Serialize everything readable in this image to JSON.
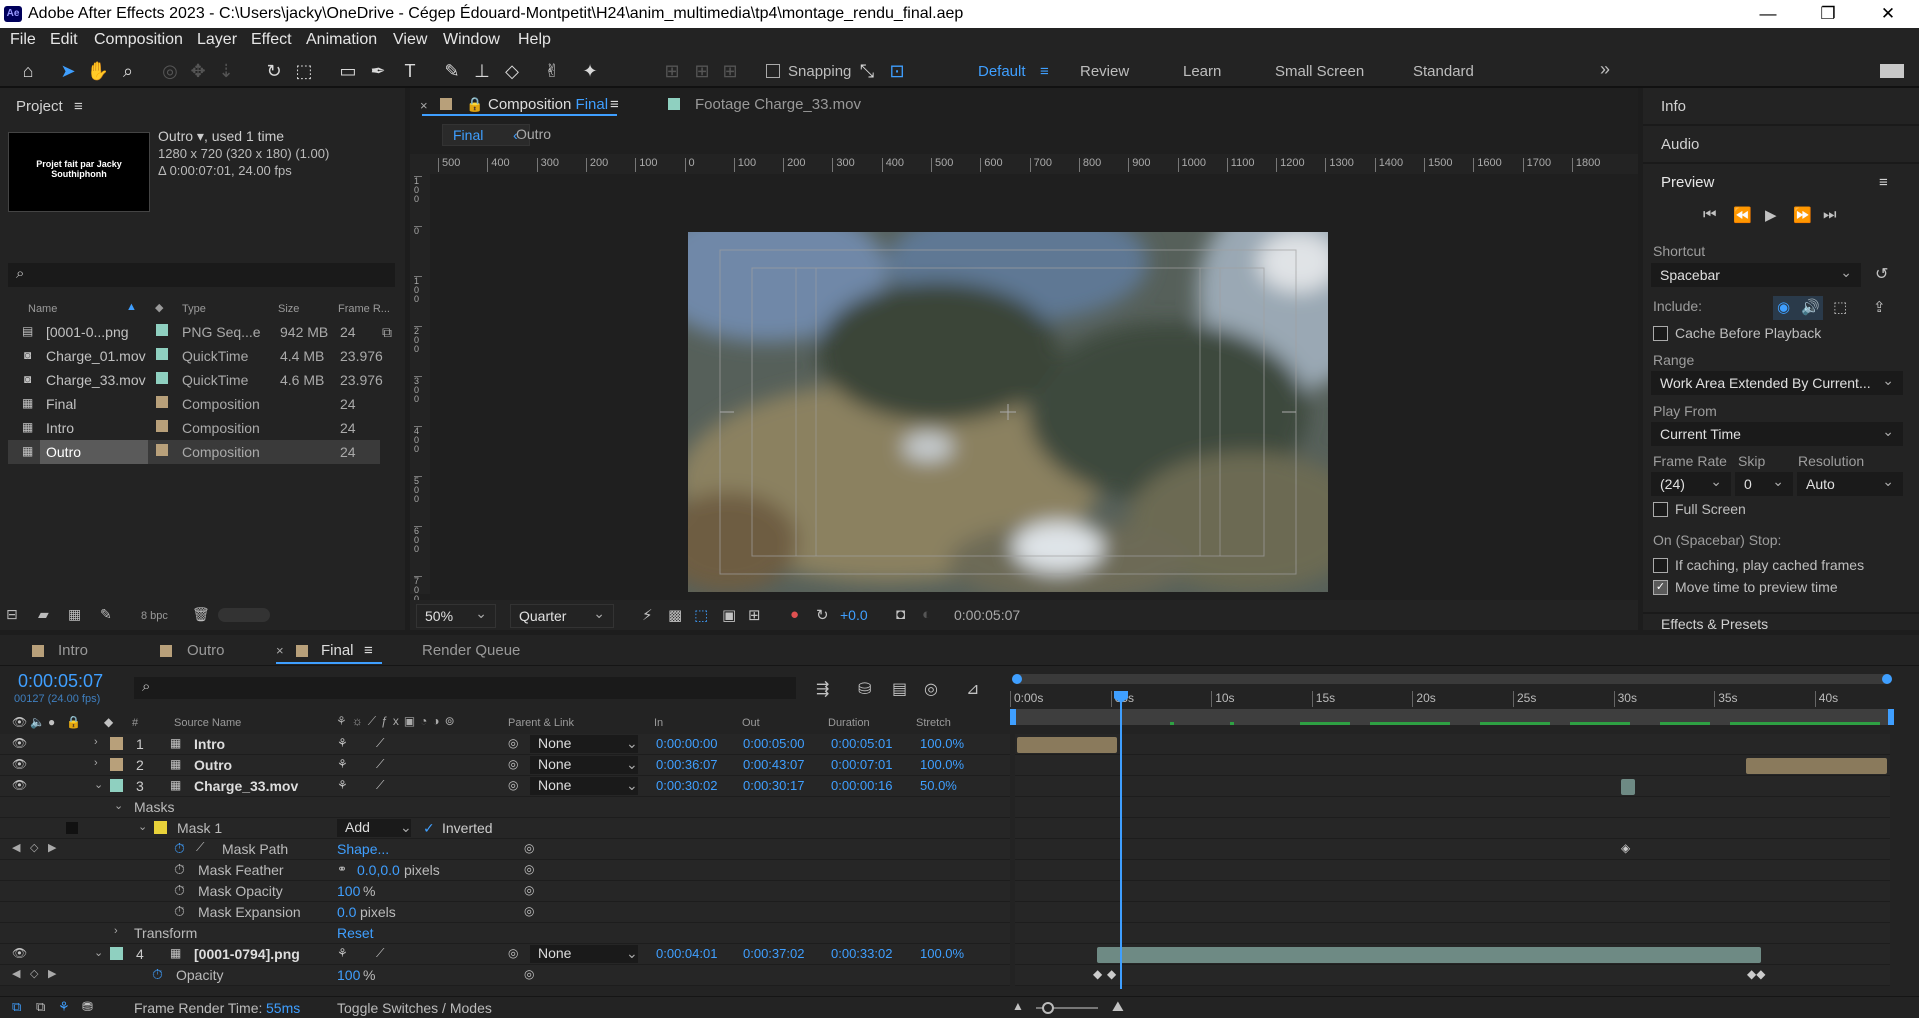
{
  "window": {
    "title": "Adobe After Effects 2023 - C:\\Users\\jacky\\OneDrive - Cégep Édouard-Montpetit\\H24\\anim_multimedia\\tp4\\montage_rendu_final.aep"
  },
  "menu": [
    "File",
    "Edit",
    "Composition",
    "Layer",
    "Effect",
    "Animation",
    "View",
    "Window",
    "Help"
  ],
  "toolbar": {
    "snapping": "Snapping",
    "workspaces": [
      "Default",
      "Review",
      "Learn",
      "Small Screen",
      "Standard"
    ]
  },
  "project": {
    "header": "Project",
    "thumb_text": "Projet fait par Jacky Southiphonh",
    "selected_name": "Outro",
    "used": ", used 1 time",
    "dims": "1280 x 720  (320 x 180) (1.00)",
    "duration": "Δ 0:00:07:01, 24.00 fps",
    "search_placeholder": "",
    "columns": [
      "Name",
      "Type",
      "Size",
      "Frame R..."
    ],
    "items": [
      {
        "name": "[0001-0...png",
        "type": "PNG Seq...e",
        "size": "942 MB",
        "fr": "24",
        "color": "#8fd0c0"
      },
      {
        "name": "Charge_01.mov",
        "type": "QuickTime",
        "size": "4.4 MB",
        "fr": "23.976",
        "color": "#8fd0c0"
      },
      {
        "name": "Charge_33.mov",
        "type": "QuickTime",
        "size": "4.6 MB",
        "fr": "23.976",
        "color": "#8fd0c0"
      },
      {
        "name": "Final",
        "type": "Composition",
        "size": "",
        "fr": "24",
        "color": "#b8a07a"
      },
      {
        "name": "Intro",
        "type": "Composition",
        "size": "",
        "fr": "24",
        "color": "#b8a07a"
      },
      {
        "name": "Outro",
        "type": "Composition",
        "size": "",
        "fr": "24",
        "color": "#b8a07a"
      }
    ],
    "bpc": "8 bpc"
  },
  "viewer": {
    "tab_prefix": "Composition",
    "tab_name": "Final",
    "footage_tab": "Footage  Charge_33.mov",
    "crumbs": [
      "Final",
      "Outro"
    ],
    "hruler": [
      "500",
      "400",
      "300",
      "200",
      "100",
      "0",
      "100",
      "200",
      "300",
      "400",
      "500",
      "600",
      "700",
      "800",
      "900",
      "1000",
      "1100",
      "1200",
      "1300",
      "1400",
      "1500",
      "1600",
      "1700",
      "1800"
    ],
    "vruler": [
      "100",
      "0",
      "100",
      "200",
      "300",
      "400",
      "500",
      "600",
      "700"
    ],
    "zoom": "50%",
    "resolution": "Quarter",
    "exposure": "+0.0",
    "timecode": "0:00:05:07"
  },
  "right": {
    "info": "Info",
    "audio": "Audio",
    "preview": "Preview",
    "shortcut_label": "Shortcut",
    "shortcut": "Spacebar",
    "include": "Include:",
    "cache": "Cache Before Playback",
    "range_label": "Range",
    "range": "Work Area Extended By Current...",
    "playfrom_label": "Play From",
    "playfrom": "Current Time",
    "fr_label": "Frame Rate",
    "skip_label": "Skip",
    "res_label": "Resolution",
    "fr": "(24)",
    "skip": "0",
    "res": "Auto",
    "fullscreen": "Full Screen",
    "stop_label": "On (Spacebar) Stop:",
    "caching": "If caching, play cached frames",
    "movetime": "Move time to preview time",
    "effects": "Effects & Presets"
  },
  "timeline": {
    "tabs": [
      "Intro",
      "Outro",
      "Final",
      "Render Queue"
    ],
    "timecode": "0:00:05:07",
    "frames": "00127 (24.00 fps)",
    "col_source": "Source Name",
    "col_parent": "Parent & Link",
    "col_in": "In",
    "col_out": "Out",
    "col_dur": "Duration",
    "col_stretch": "Stretch",
    "hash": "#",
    "ruler": [
      "0:00s",
      "05s",
      "10s",
      "15s",
      "20s",
      "25s",
      "30s",
      "35s",
      "40s"
    ],
    "layers": [
      {
        "num": "1",
        "name": "Intro",
        "parent": "None",
        "in": "0:00:00:00",
        "out": "0:00:05:00",
        "dur": "0:00:05:01",
        "stretch": "100.0%",
        "color": "#b8a07a"
      },
      {
        "num": "2",
        "name": "Outro",
        "parent": "None",
        "in": "0:00:36:07",
        "out": "0:00:43:07",
        "dur": "0:00:07:01",
        "stretch": "100.0%",
        "color": "#b8a07a"
      },
      {
        "num": "3",
        "name": "Charge_33.mov",
        "parent": "None",
        "in": "0:00:30:02",
        "out": "0:00:30:17",
        "dur": "0:00:00:16",
        "stretch": "50.0%",
        "color": "#8fd0c0"
      },
      {
        "num": "4",
        "name": "[0001-0794].png",
        "parent": "None",
        "in": "0:00:04:01",
        "out": "0:00:37:02",
        "dur": "0:00:33:02",
        "stretch": "100.0%",
        "color": "#8fd0c0"
      }
    ],
    "masks": "Masks",
    "mask1": "Mask 1",
    "mask_mode": "Add",
    "inverted": "Inverted",
    "mask_path": "Mask Path",
    "mask_path_val": "Shape...",
    "mask_feather": "Mask Feather",
    "mask_feather_val": "0.0,0.0",
    "pixels": "pixels",
    "mask_opacity": "Mask Opacity",
    "mask_opacity_val": "100",
    "mask_expansion": "Mask Expansion",
    "mask_expansion_val": "0.0",
    "transform": "Transform",
    "reset": "Reset",
    "opacity": "Opacity",
    "opacity_val": "100",
    "percent": "%",
    "render_time_label": "Frame Render Time:",
    "render_time": "55ms",
    "toggle": "Toggle Switches / Modes"
  }
}
